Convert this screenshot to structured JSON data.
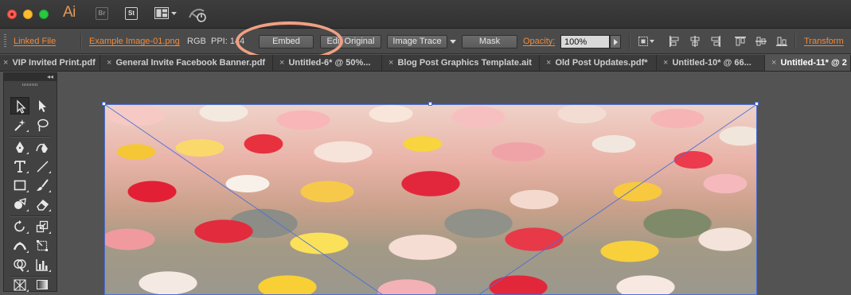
{
  "window": {
    "app_logo": "Ai",
    "bridge_label": "Br",
    "stock_label": "St"
  },
  "control_bar": {
    "linked_file": "Linked File",
    "file_name": "Example Image-01.png",
    "color_mode": "RGB",
    "ppi": "PPI: 144",
    "embed": "Embed",
    "edit_original": "Edit Original",
    "image_trace": "Image Trace",
    "mask": "Mask",
    "opacity_label": "Opacity:",
    "opacity_value": "100%",
    "transform": "Transform"
  },
  "tabs": [
    {
      "label": "VIP Invited Print.pdf",
      "active": false
    },
    {
      "label": "General Invite Facebook Banner.pdf",
      "active": false
    },
    {
      "label": "Untitled-6* @ 50%...",
      "active": false
    },
    {
      "label": "Blog Post Graphics Template.ait",
      "active": false
    },
    {
      "label": "Old Post Updates.pdf*",
      "active": false
    },
    {
      "label": "Untitled-10* @ 66...",
      "active": false
    },
    {
      "label": "Untitled-11* @ 2",
      "active": true
    }
  ],
  "tools": [
    "selection-tool",
    "direct-selection-tool",
    "magic-wand-tool",
    "lasso-tool",
    "pen-tool",
    "curvature-tool",
    "type-tool",
    "line-segment-tool",
    "rectangle-tool",
    "paintbrush-tool",
    "shaper-tool",
    "eraser-tool",
    "rotate-tool",
    "scale-tool",
    "width-tool",
    "free-transform-tool",
    "shape-builder-tool",
    "graph-tool",
    "perspective-grid-tool",
    "gradient-tool"
  ],
  "colors": {
    "accent_orange": "#f08a3b",
    "highlight_ring": "#f0a083",
    "selection_blue": "#4b6fd9"
  }
}
